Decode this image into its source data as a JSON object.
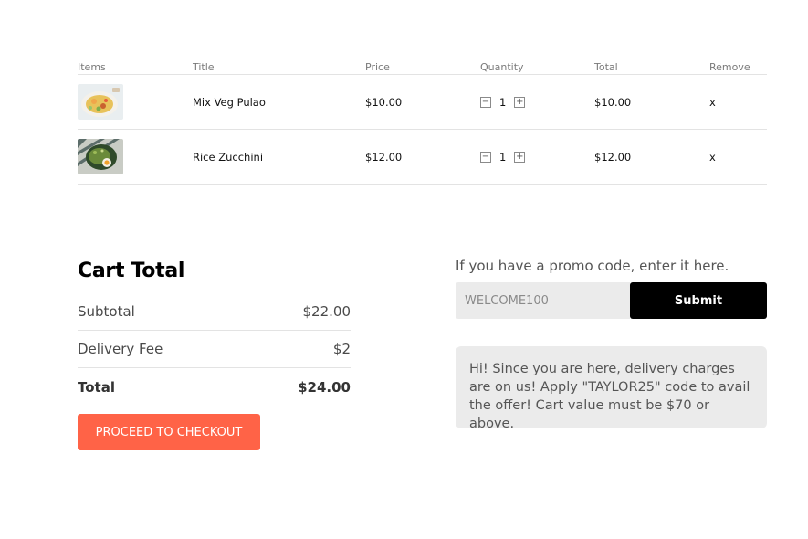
{
  "cart": {
    "headers": {
      "items": "Items",
      "title": "Title",
      "price": "Price",
      "quantity": "Quantity",
      "total": "Total",
      "remove": "Remove"
    },
    "rows": [
      {
        "title": "Mix Veg Pulao",
        "price": "$10.00",
        "quantity": "1",
        "total": "$10.00",
        "remove": "x",
        "image": "food-pulao-image"
      },
      {
        "title": "Rice Zucchini",
        "price": "$12.00",
        "quantity": "1",
        "total": "$12.00",
        "remove": "x",
        "image": "food-zucchini-image"
      }
    ],
    "qty_minus": "−",
    "qty_plus": "+"
  },
  "cart_total": {
    "heading": "Cart Total",
    "subtotal_label": "Subtotal",
    "subtotal_value": "$22.00",
    "delivery_label": "Delivery Fee",
    "delivery_value": "$2",
    "total_label": "Total",
    "total_value": "$24.00",
    "checkout_label": "PROCEED TO CHECKOUT",
    "checkout_color": "#ff6347"
  },
  "promo": {
    "prompt": "If you have a promo code, enter it here.",
    "placeholder": "WELCOME100",
    "submit_label": "Submit",
    "note": "Hi! Since you are here, delivery charges are on us! Apply \"TAYLOR25\" code to avail the offer! Cart value must be $70 or above."
  }
}
